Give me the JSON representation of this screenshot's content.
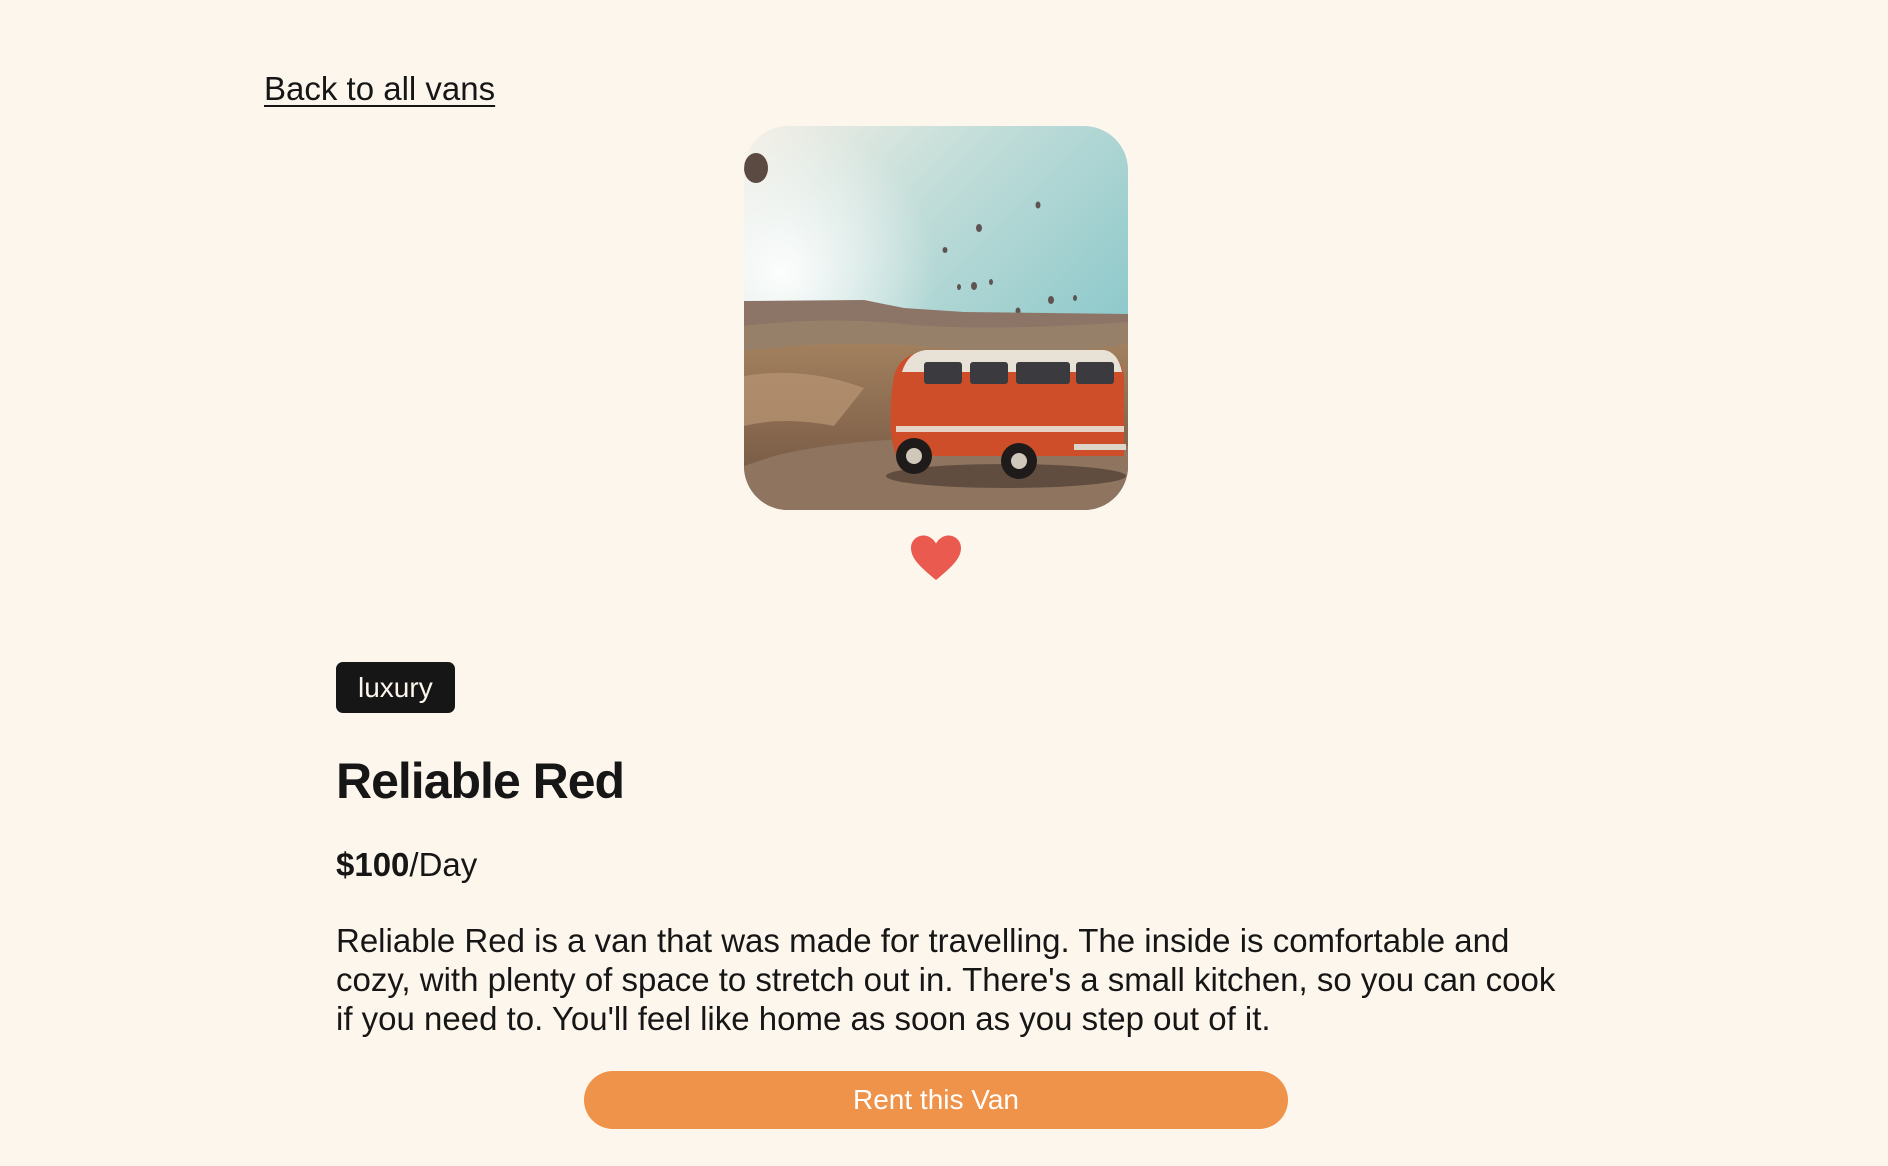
{
  "nav": {
    "back_label": "Back to all vans"
  },
  "van": {
    "image_icon": "van-photo",
    "favorite_icon": "heart-icon",
    "favorite_color": "#ea5a4f",
    "type": "luxury",
    "name": "Reliable Red",
    "price": "$100",
    "price_unit": "/Day",
    "description": "Reliable Red is a van that was made for travelling. The inside is comfortable and cozy, with plenty of space to stretch out in. There's a small kitchen, so you can cook if you need to. You'll feel like home as soon as you step out of it."
  },
  "actions": {
    "rent_label": "Rent this Van"
  },
  "colors": {
    "background": "#fdf6ed",
    "accent": "#ef934a",
    "badge_bg": "#161616"
  }
}
